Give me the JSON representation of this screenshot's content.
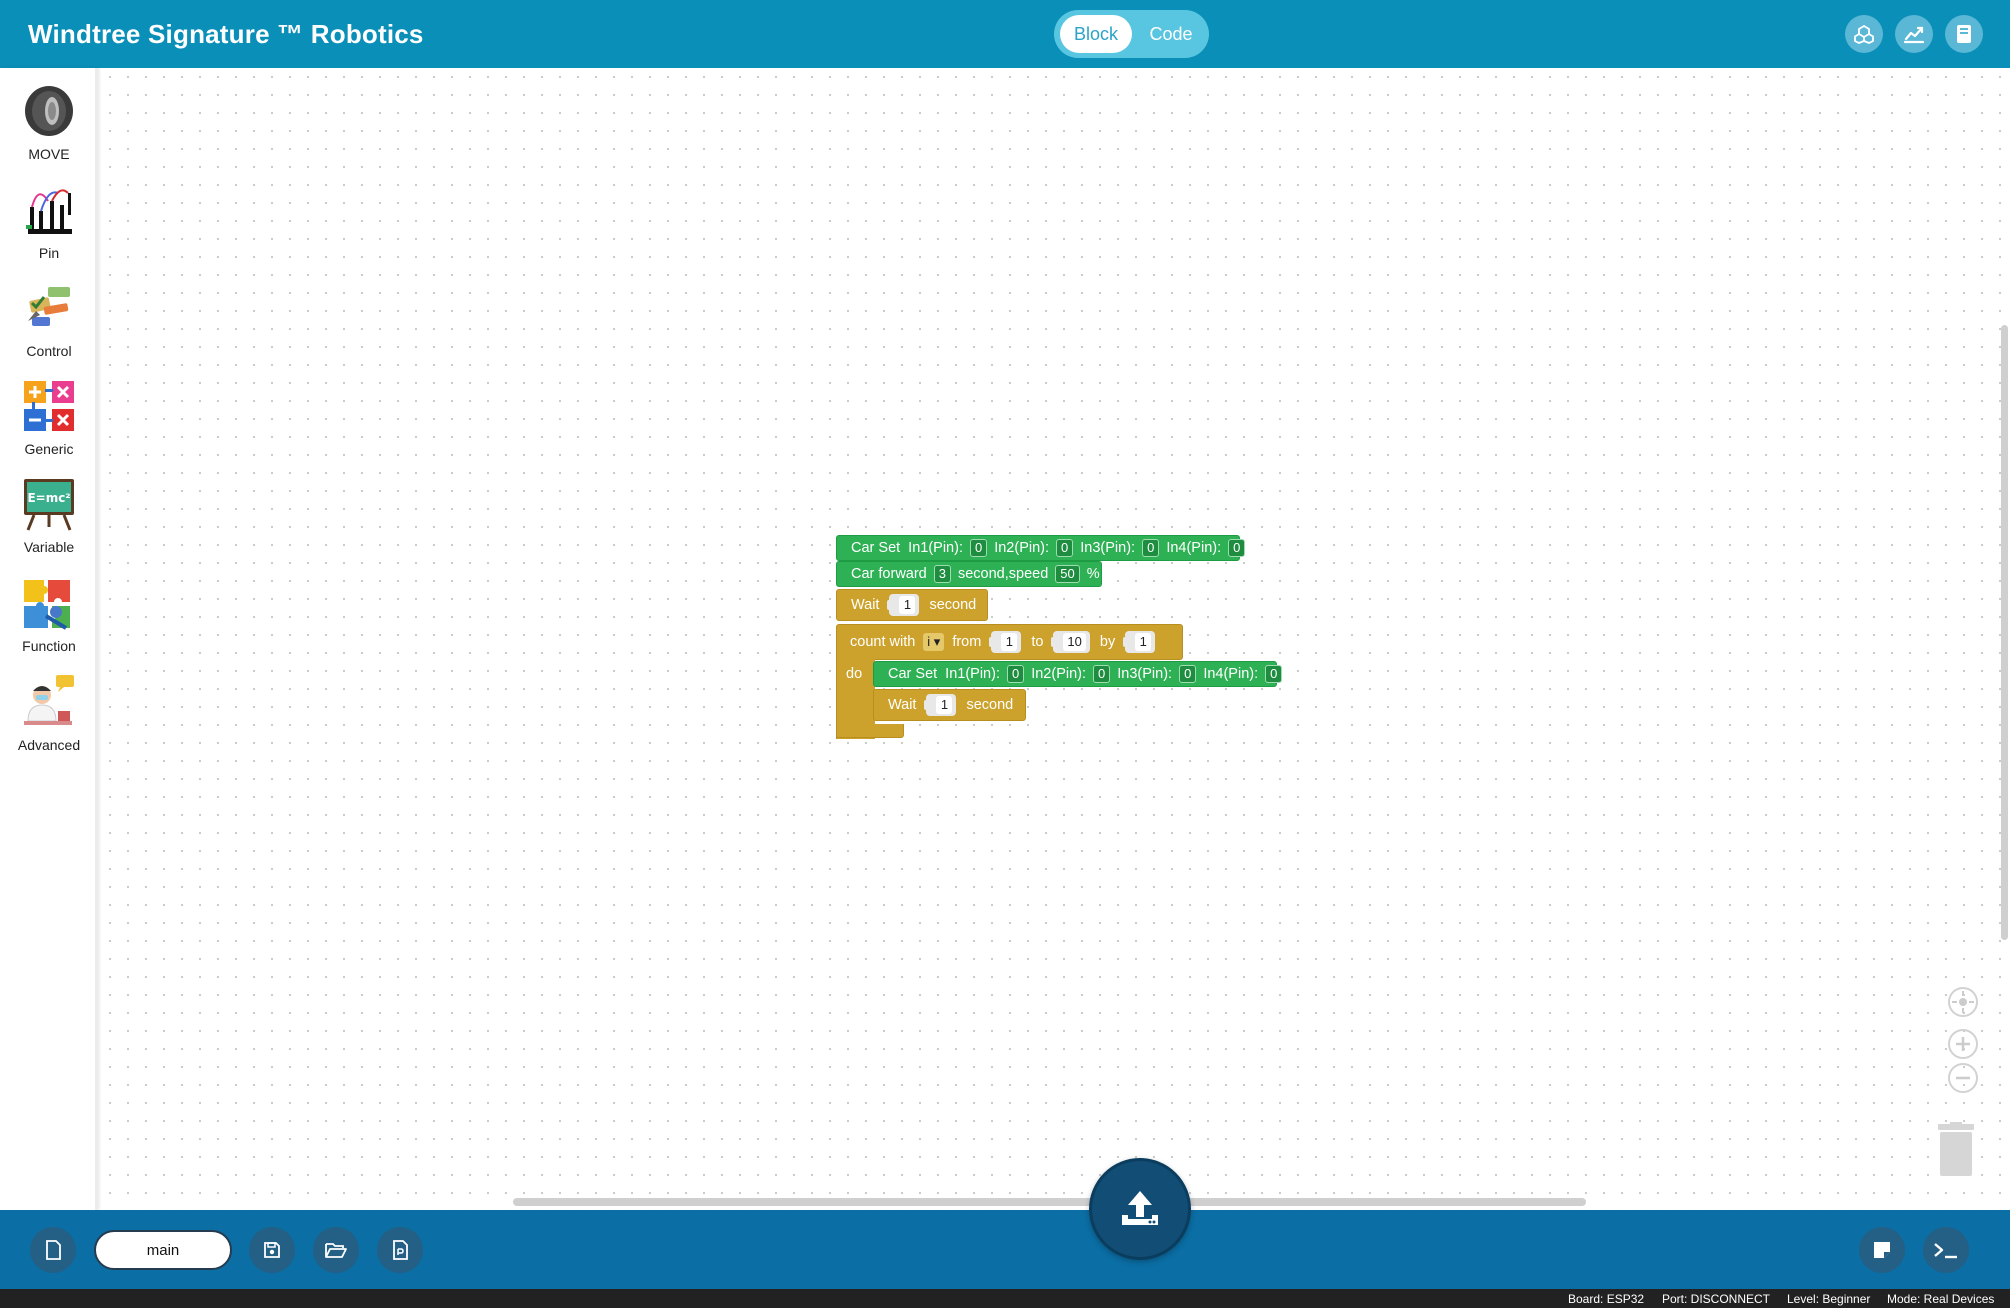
{
  "header": {
    "title": "Windtree Signature ™ Robotics",
    "modes": [
      "Block",
      "Code"
    ],
    "active_mode": "Block",
    "buttons": [
      "cube-icon",
      "chart-icon",
      "book-icon"
    ]
  },
  "sidebar": {
    "categories": [
      {
        "label": "MOVE",
        "icon": "tire-icon"
      },
      {
        "label": "Pin",
        "icon": "pin-icon"
      },
      {
        "label": "Control",
        "icon": "control-icon"
      },
      {
        "label": "Generic",
        "icon": "generic-icon"
      },
      {
        "label": "Variable",
        "icon": "variable-icon"
      },
      {
        "label": "Function",
        "icon": "puzzle-icon"
      },
      {
        "label": "Advanced",
        "icon": "advanced-icon"
      }
    ]
  },
  "blocks": {
    "car_set_1": {
      "label": "Car Set",
      "in1_label": "In1(Pin):",
      "in1": "0",
      "in2_label": "In2(Pin):",
      "in2": "0",
      "in3_label": "In3(Pin):",
      "in3": "0",
      "in4_label": "In4(Pin):",
      "in4": "0"
    },
    "car_forward": {
      "label": "Car forward",
      "seconds": "3",
      "mid_label": "second,speed",
      "speed": "50",
      "unit": "%"
    },
    "wait_1": {
      "label": "Wait",
      "value": "1",
      "unit": "second"
    },
    "count_loop": {
      "label": "count with",
      "var": "i",
      "from_label": "from",
      "from": "1",
      "to_label": "to",
      "to": "10",
      "by_label": "by",
      "by": "1",
      "do_label": "do"
    },
    "car_set_2": {
      "label": "Car Set",
      "in1_label": "In1(Pin):",
      "in1": "0",
      "in2_label": "In2(Pin):",
      "in2": "0",
      "in3_label": "In3(Pin):",
      "in3": "0",
      "in4_label": "In4(Pin):",
      "in4": "0"
    },
    "wait_2": {
      "label": "Wait",
      "value": "1",
      "unit": "second"
    }
  },
  "footer": {
    "filename": "main"
  },
  "status": {
    "board": "Board: ESP32",
    "port": "Port: DISCONNECT",
    "level": "Level: Beginner",
    "mode": "Mode: Real Devices"
  },
  "colors": {
    "header": "#0a8fb8",
    "footer": "#0b6ea4",
    "motion_block": "#2db154",
    "control_block": "#cda22c"
  }
}
